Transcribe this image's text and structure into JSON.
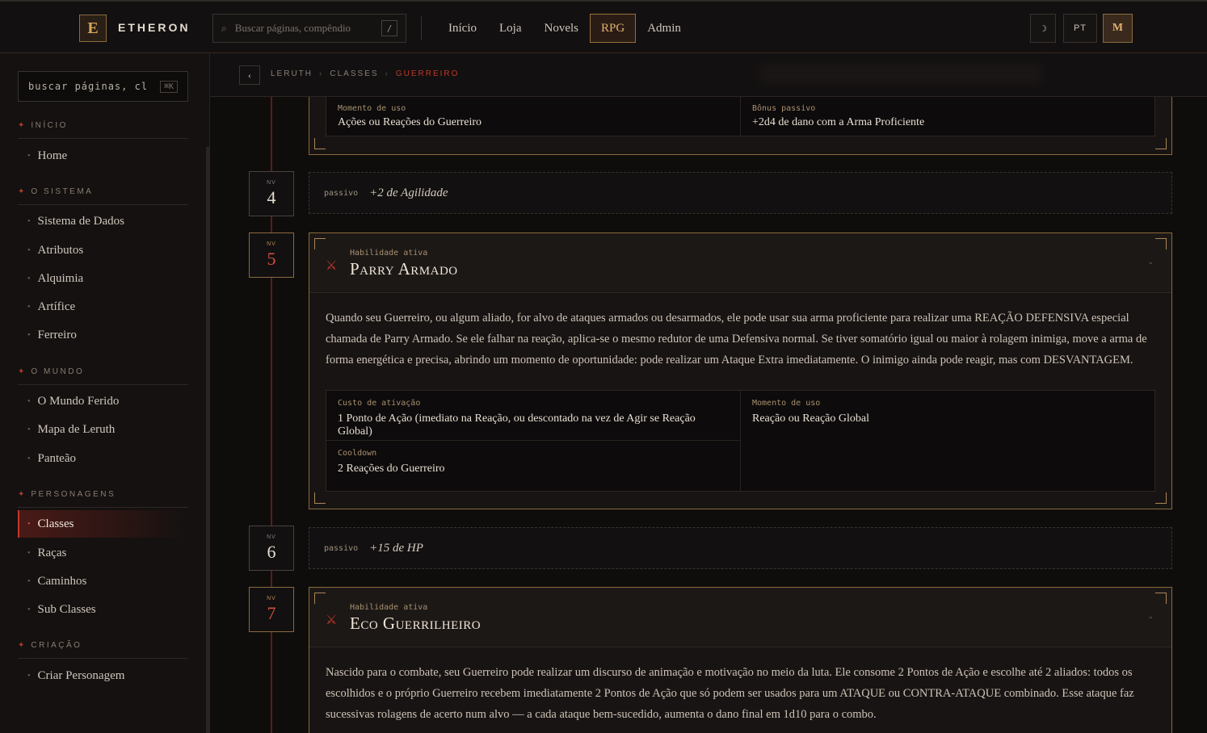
{
  "brand": {
    "logo_letter": "E",
    "name": "ETHERON"
  },
  "top_search": {
    "placeholder": "Buscar páginas, compêndio",
    "shortcut": "/"
  },
  "nav": [
    "Início",
    "Loja",
    "Novels",
    "RPG",
    "Admin"
  ],
  "nav_active": "RPG",
  "top_actions": {
    "theme_icon": "☽",
    "lang": "PT",
    "user_initial": "M"
  },
  "sidebar": {
    "search_placeholder": "buscar páginas, cl",
    "search_shortcut": "⌘K",
    "sections": [
      {
        "title": "INÍCIO",
        "items": [
          "Home"
        ]
      },
      {
        "title": "O SISTEMA",
        "items": [
          "Sistema de Dados",
          "Atributos",
          "Alquimia",
          "Artífice",
          "Ferreiro"
        ]
      },
      {
        "title": "O MUNDO",
        "items": [
          "O Mundo Ferido",
          "Mapa de Leruth",
          "Panteão"
        ]
      },
      {
        "title": "PERSONAGENS",
        "items": [
          "Classes",
          "Raças",
          "Caminhos",
          "Sub Classes"
        ]
      },
      {
        "title": "CRIAÇÃO",
        "items": [
          "Criar Personagem"
        ]
      }
    ],
    "active_item": "Classes"
  },
  "breadcrumb": {
    "items": [
      "LERUTH",
      "CLASSES"
    ],
    "current": "GUERREIRO",
    "separator": "›"
  },
  "prev_card": {
    "stats": [
      {
        "label": "Momento de uso",
        "value": "Ações ou Reações do Guerreiro"
      },
      {
        "label": "Bônus passivo",
        "value": "+2d4 de dano com a Arma Proficiente"
      }
    ]
  },
  "levels": [
    {
      "nv": "NV",
      "num": "4"
    },
    {
      "nv": "NV",
      "num": "5"
    },
    {
      "nv": "NV",
      "num": "6"
    },
    {
      "nv": "NV",
      "num": "7"
    }
  ],
  "passives": [
    {
      "tag": "passivo",
      "value": "+2 de Agilidade"
    },
    {
      "tag": "passivo",
      "value": "+15 de HP"
    }
  ],
  "ability_5": {
    "kind": "Habilidade ativa",
    "title": "Parry Armado",
    "description": "Quando seu Guerreiro, ou algum aliado, for alvo de ataques armados ou desarmados, ele pode usar sua arma proficiente para realizar uma REAÇÃO DEFENSIVA especial chamada de Parry Armado. Se ele falhar na reação, aplica-se o mesmo redutor de uma Defensiva normal. Se tiver somatório igual ou maior à rolagem inimiga, move a arma de forma energética e precisa, abrindo um momento de oportunidade: pode realizar um Ataque Extra imediatamente. O inimigo ainda pode reagir, mas com DESVANTAGEM.",
    "stats": [
      {
        "label": "Custo de ativação",
        "value": "1 Ponto de Ação (imediato na Reação, ou descontado na vez de Agir se Reação Global)"
      },
      {
        "label": "Momento de uso",
        "value": "Reação ou Reação Global"
      },
      {
        "label": "Cooldown",
        "value": "2 Reações do Guerreiro"
      }
    ]
  },
  "ability_7": {
    "kind": "Habilidade ativa",
    "title": "Eco Guerrilheiro",
    "description": "Nascido para o combate, seu Guerreiro pode realizar um discurso de animação e motivação no meio da luta. Ele consome 2 Pontos de Ação e escolhe até 2 aliados: todos os escolhidos e o próprio Guerreiro recebem imediatamente 2 Pontos de Ação que só podem ser usados para um ATAQUE ou CONTRA-ATAQUE combinado. Esse ataque faz sucessivas rolagens de acerto num alvo — a cada ataque bem-sucedido, aumenta o dano final em 1d10 para o combo."
  },
  "colors": {
    "accent": "#c0392b",
    "gold": "#8a6a3e",
    "bg": "#0e0c0b"
  }
}
